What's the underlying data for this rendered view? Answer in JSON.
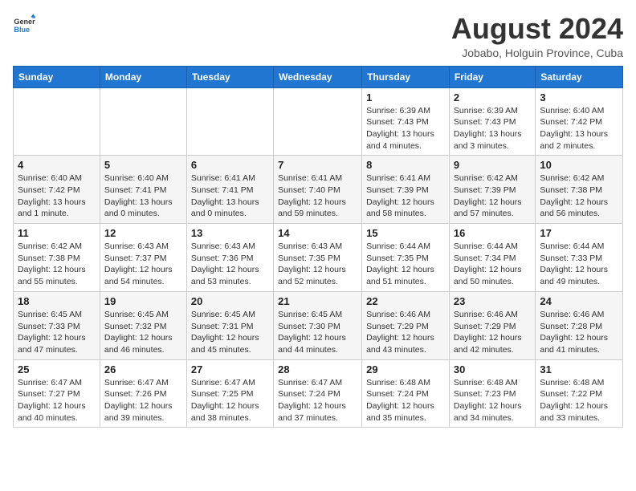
{
  "header": {
    "logo_general": "General",
    "logo_blue": "Blue",
    "title": "August 2024",
    "subtitle": "Jobabo, Holguin Province, Cuba"
  },
  "columns": [
    "Sunday",
    "Monday",
    "Tuesday",
    "Wednesday",
    "Thursday",
    "Friday",
    "Saturday"
  ],
  "weeks": [
    [
      {
        "day": "",
        "info": ""
      },
      {
        "day": "",
        "info": ""
      },
      {
        "day": "",
        "info": ""
      },
      {
        "day": "",
        "info": ""
      },
      {
        "day": "1",
        "info": "Sunrise: 6:39 AM\nSunset: 7:43 PM\nDaylight: 13 hours and 4 minutes."
      },
      {
        "day": "2",
        "info": "Sunrise: 6:39 AM\nSunset: 7:43 PM\nDaylight: 13 hours and 3 minutes."
      },
      {
        "day": "3",
        "info": "Sunrise: 6:40 AM\nSunset: 7:42 PM\nDaylight: 13 hours and 2 minutes."
      }
    ],
    [
      {
        "day": "4",
        "info": "Sunrise: 6:40 AM\nSunset: 7:42 PM\nDaylight: 13 hours and 1 minute."
      },
      {
        "day": "5",
        "info": "Sunrise: 6:40 AM\nSunset: 7:41 PM\nDaylight: 13 hours and 0 minutes."
      },
      {
        "day": "6",
        "info": "Sunrise: 6:41 AM\nSunset: 7:41 PM\nDaylight: 13 hours and 0 minutes."
      },
      {
        "day": "7",
        "info": "Sunrise: 6:41 AM\nSunset: 7:40 PM\nDaylight: 12 hours and 59 minutes."
      },
      {
        "day": "8",
        "info": "Sunrise: 6:41 AM\nSunset: 7:39 PM\nDaylight: 12 hours and 58 minutes."
      },
      {
        "day": "9",
        "info": "Sunrise: 6:42 AM\nSunset: 7:39 PM\nDaylight: 12 hours and 57 minutes."
      },
      {
        "day": "10",
        "info": "Sunrise: 6:42 AM\nSunset: 7:38 PM\nDaylight: 12 hours and 56 minutes."
      }
    ],
    [
      {
        "day": "11",
        "info": "Sunrise: 6:42 AM\nSunset: 7:38 PM\nDaylight: 12 hours and 55 minutes."
      },
      {
        "day": "12",
        "info": "Sunrise: 6:43 AM\nSunset: 7:37 PM\nDaylight: 12 hours and 54 minutes."
      },
      {
        "day": "13",
        "info": "Sunrise: 6:43 AM\nSunset: 7:36 PM\nDaylight: 12 hours and 53 minutes."
      },
      {
        "day": "14",
        "info": "Sunrise: 6:43 AM\nSunset: 7:35 PM\nDaylight: 12 hours and 52 minutes."
      },
      {
        "day": "15",
        "info": "Sunrise: 6:44 AM\nSunset: 7:35 PM\nDaylight: 12 hours and 51 minutes."
      },
      {
        "day": "16",
        "info": "Sunrise: 6:44 AM\nSunset: 7:34 PM\nDaylight: 12 hours and 50 minutes."
      },
      {
        "day": "17",
        "info": "Sunrise: 6:44 AM\nSunset: 7:33 PM\nDaylight: 12 hours and 49 minutes."
      }
    ],
    [
      {
        "day": "18",
        "info": "Sunrise: 6:45 AM\nSunset: 7:33 PM\nDaylight: 12 hours and 47 minutes."
      },
      {
        "day": "19",
        "info": "Sunrise: 6:45 AM\nSunset: 7:32 PM\nDaylight: 12 hours and 46 minutes."
      },
      {
        "day": "20",
        "info": "Sunrise: 6:45 AM\nSunset: 7:31 PM\nDaylight: 12 hours and 45 minutes."
      },
      {
        "day": "21",
        "info": "Sunrise: 6:45 AM\nSunset: 7:30 PM\nDaylight: 12 hours and 44 minutes."
      },
      {
        "day": "22",
        "info": "Sunrise: 6:46 AM\nSunset: 7:29 PM\nDaylight: 12 hours and 43 minutes."
      },
      {
        "day": "23",
        "info": "Sunrise: 6:46 AM\nSunset: 7:29 PM\nDaylight: 12 hours and 42 minutes."
      },
      {
        "day": "24",
        "info": "Sunrise: 6:46 AM\nSunset: 7:28 PM\nDaylight: 12 hours and 41 minutes."
      }
    ],
    [
      {
        "day": "25",
        "info": "Sunrise: 6:47 AM\nSunset: 7:27 PM\nDaylight: 12 hours and 40 minutes."
      },
      {
        "day": "26",
        "info": "Sunrise: 6:47 AM\nSunset: 7:26 PM\nDaylight: 12 hours and 39 minutes."
      },
      {
        "day": "27",
        "info": "Sunrise: 6:47 AM\nSunset: 7:25 PM\nDaylight: 12 hours and 38 minutes."
      },
      {
        "day": "28",
        "info": "Sunrise: 6:47 AM\nSunset: 7:24 PM\nDaylight: 12 hours and 37 minutes."
      },
      {
        "day": "29",
        "info": "Sunrise: 6:48 AM\nSunset: 7:24 PM\nDaylight: 12 hours and 35 minutes."
      },
      {
        "day": "30",
        "info": "Sunrise: 6:48 AM\nSunset: 7:23 PM\nDaylight: 12 hours and 34 minutes."
      },
      {
        "day": "31",
        "info": "Sunrise: 6:48 AM\nSunset: 7:22 PM\nDaylight: 12 hours and 33 minutes."
      }
    ]
  ]
}
